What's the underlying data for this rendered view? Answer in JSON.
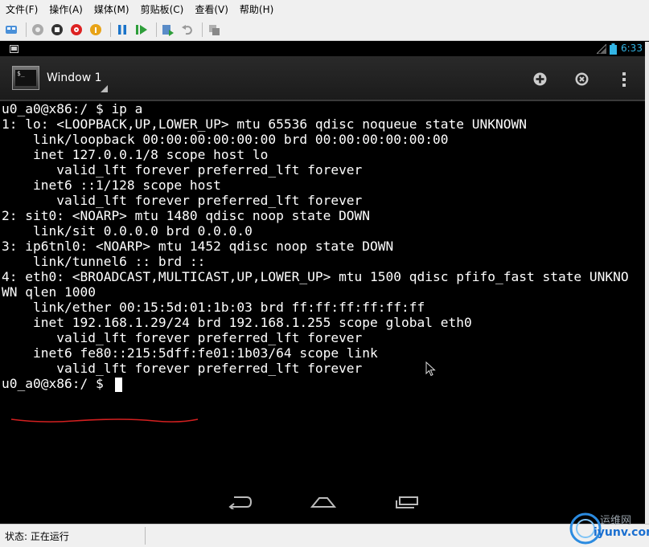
{
  "menubar": {
    "items": [
      {
        "label": "文件(F)"
      },
      {
        "label": "操作(A)"
      },
      {
        "label": "媒体(M)"
      },
      {
        "label": "剪贴板(C)"
      },
      {
        "label": "查看(V)"
      },
      {
        "label": "帮助(H)"
      }
    ]
  },
  "toolbar": {
    "icons": [
      "ctrl-alt-del-icon",
      "start-icon",
      "stop-icon",
      "shutdown-icon",
      "power-icon",
      "pause-icon",
      "resume-icon",
      "checkpoint-icon",
      "revert-icon",
      "share-icon"
    ]
  },
  "android_status": {
    "time": "6:33"
  },
  "actionbar": {
    "title": "Window 1",
    "app_icon_text": "$_"
  },
  "terminal": {
    "lines": [
      "u0_a0@x86:/ $ ip a",
      "1: lo: <LOOPBACK,UP,LOWER_UP> mtu 65536 qdisc noqueue state UNKNOWN",
      "    link/loopback 00:00:00:00:00:00 brd 00:00:00:00:00:00",
      "    inet 127.0.0.1/8 scope host lo",
      "       valid_lft forever preferred_lft forever",
      "    inet6 ::1/128 scope host",
      "       valid_lft forever preferred_lft forever",
      "2: sit0: <NOARP> mtu 1480 qdisc noop state DOWN",
      "    link/sit 0.0.0.0 brd 0.0.0.0",
      "3: ip6tnl0: <NOARP> mtu 1452 qdisc noop state DOWN",
      "    link/tunnel6 :: brd ::",
      "4: eth0: <BROADCAST,MULTICAST,UP,LOWER_UP> mtu 1500 qdisc pfifo_fast state UNKNO",
      "WN qlen 1000",
      "    link/ether 00:15:5d:01:1b:03 brd ff:ff:ff:ff:ff:ff",
      "    inet 192.168.1.29/24 brd 192.168.1.255 scope global eth0",
      "       valid_lft forever preferred_lft forever",
      "    inet6 fe80::215:5dff:fe01:1b03/64 scope link",
      "       valid_lft forever preferred_lft forever",
      "u0_a0@x86:/ $ "
    ]
  },
  "host_status": {
    "text": "状态: 正在运行"
  },
  "watermark": {
    "cn": "运维网",
    "url": "iyunv.com"
  },
  "colors": {
    "android_accent": "#33b5e5",
    "annotation_red": "#d42020",
    "terminal_bg": "#000000",
    "terminal_fg": "#ffffff"
  }
}
